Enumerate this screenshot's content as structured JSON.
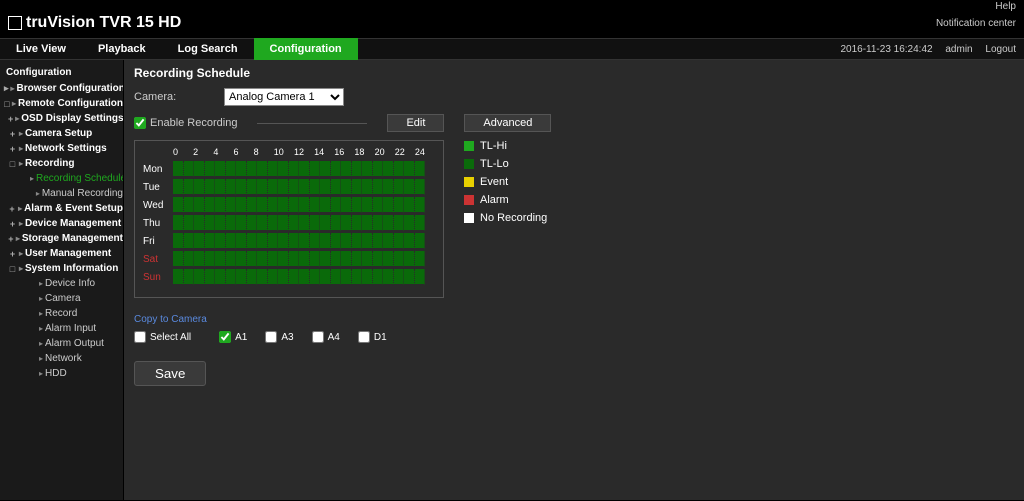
{
  "top": {
    "help": "Help",
    "notification": "Notification center"
  },
  "brand": "truVision TVR 15 HD",
  "navbar": {
    "items": [
      "Live View",
      "Playback",
      "Log Search",
      "Configuration"
    ],
    "active_index": 3,
    "datetime": "2016-11-23 16:24:42",
    "admin": "admin",
    "logout": "Logout"
  },
  "sidebar": {
    "title": "Configuration",
    "items": [
      {
        "label": "Browser Configuration",
        "level": 0,
        "bold": true,
        "expander": "▸",
        "node": true
      },
      {
        "label": "Remote Configuration",
        "level": 0,
        "bold": true,
        "expander": "□",
        "node": true
      },
      {
        "label": "OSD Display Settings",
        "level": 1,
        "bold": true,
        "expander": "+",
        "node": true
      },
      {
        "label": "Camera Setup",
        "level": 1,
        "bold": true,
        "expander": "+",
        "node": true
      },
      {
        "label": "Network Settings",
        "level": 1,
        "bold": true,
        "expander": "+",
        "node": true
      },
      {
        "label": "Recording",
        "level": 1,
        "bold": true,
        "expander": "□",
        "node": true
      },
      {
        "label": "Recording Schedule",
        "level": 2,
        "active": true,
        "leaf": true
      },
      {
        "label": "Manual Recording",
        "level": 2,
        "leaf": true
      },
      {
        "label": "Alarm & Event Setup",
        "level": 1,
        "bold": true,
        "expander": "+",
        "node": true
      },
      {
        "label": "Device Management",
        "level": 1,
        "bold": true,
        "expander": "+",
        "node": true
      },
      {
        "label": "Storage Management",
        "level": 1,
        "bold": true,
        "expander": "+",
        "node": true
      },
      {
        "label": "User Management",
        "level": 1,
        "bold": true,
        "expander": "+",
        "node": true
      },
      {
        "label": "System Information",
        "level": 1,
        "bold": true,
        "expander": "□",
        "node": true
      },
      {
        "label": "Device Info",
        "level": 2,
        "leaf": true
      },
      {
        "label": "Camera",
        "level": 2,
        "leaf": true
      },
      {
        "label": "Record",
        "level": 2,
        "leaf": true
      },
      {
        "label": "Alarm Input",
        "level": 2,
        "leaf": true
      },
      {
        "label": "Alarm Output",
        "level": 2,
        "leaf": true
      },
      {
        "label": "Network",
        "level": 2,
        "leaf": true
      },
      {
        "label": "HDD",
        "level": 2,
        "leaf": true
      }
    ]
  },
  "content": {
    "title": "Recording Schedule",
    "camera_label": "Camera:",
    "camera_value": "Analog Camera 1",
    "enable_recording": "Enable Recording",
    "edit_btn": "Edit",
    "advanced_btn": "Advanced",
    "hours": [
      "0",
      "2",
      "4",
      "6",
      "8",
      "10",
      "12",
      "14",
      "16",
      "18",
      "20",
      "22",
      "24"
    ],
    "days": [
      {
        "label": "Mon",
        "weekend": false
      },
      {
        "label": "Tue",
        "weekend": false
      },
      {
        "label": "Wed",
        "weekend": false
      },
      {
        "label": "Thu",
        "weekend": false
      },
      {
        "label": "Fri",
        "weekend": false
      },
      {
        "label": "Sat",
        "weekend": true
      },
      {
        "label": "Sun",
        "weekend": true
      }
    ],
    "legend": [
      {
        "label": "TL-Hi",
        "color": "#1fa81f"
      },
      {
        "label": "TL-Lo",
        "color": "#0a6a0a"
      },
      {
        "label": "Event",
        "color": "#e8d000"
      },
      {
        "label": "Alarm",
        "color": "#cc3333"
      },
      {
        "label": "No Recording",
        "color": "#ffffff"
      }
    ],
    "copy_link": "Copy to Camera",
    "select_all": "Select All",
    "copy_targets": [
      {
        "label": "A1",
        "checked": true
      },
      {
        "label": "A3",
        "checked": false
      },
      {
        "label": "A4",
        "checked": false
      },
      {
        "label": "D1",
        "checked": false
      }
    ],
    "save_btn": "Save"
  }
}
